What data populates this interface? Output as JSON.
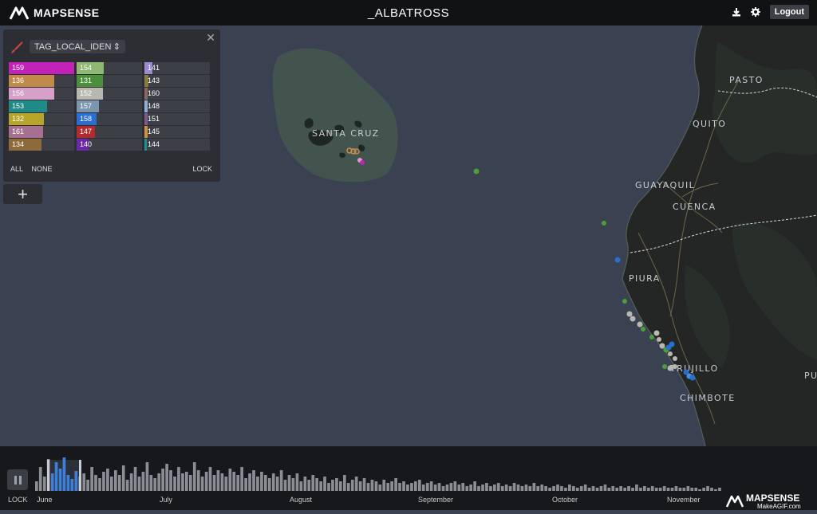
{
  "app": {
    "brand": "MAPSENSE",
    "title": "_ALBATROSS",
    "logout_label": "Logout"
  },
  "panel": {
    "dimension": "TAG_LOCAL_IDEN",
    "columns": [
      [
        {
          "label": "159",
          "color": "#c322b8",
          "fill": 1.0
        },
        {
          "label": "136",
          "color": "#c08a4a",
          "fill": 0.7
        },
        {
          "label": "156",
          "color": "#d7a0c8",
          "fill": 0.7
        },
        {
          "label": "153",
          "color": "#1f8a88",
          "fill": 0.58
        },
        {
          "label": "132",
          "color": "#b7a42a",
          "fill": 0.54
        },
        {
          "label": "161",
          "color": "#a87090",
          "fill": 0.52
        },
        {
          "label": "134",
          "color": "#8d6a3a",
          "fill": 0.5
        }
      ],
      [
        {
          "label": "154",
          "color": "#8fb873",
          "fill": 0.42
        },
        {
          "label": "131",
          "color": "#4b8e3c",
          "fill": 0.4
        },
        {
          "label": "152",
          "color": "#b8b8b0",
          "fill": 0.4
        },
        {
          "label": "157",
          "color": "#7d96b0",
          "fill": 0.34
        },
        {
          "label": "158",
          "color": "#2a6fd0",
          "fill": 0.3
        },
        {
          "label": "147",
          "color": "#b32a2a",
          "fill": 0.28
        },
        {
          "label": "140",
          "color": "#6a2aa8",
          "fill": 0.18
        }
      ],
      [
        {
          "label": "141",
          "color": "#9a8ad0",
          "fill": 0.12
        },
        {
          "label": "143",
          "color": "#8a7a3a",
          "fill": 0.06
        },
        {
          "label": "160",
          "color": "#8a6a60",
          "fill": 0.05
        },
        {
          "label": "148",
          "color": "#8ab0d8",
          "fill": 0.05
        },
        {
          "label": "151",
          "color": "#7d5a8a",
          "fill": 0.05
        },
        {
          "label": "145",
          "color": "#d09040",
          "fill": 0.05
        },
        {
          "label": "144",
          "color": "#1f9090",
          "fill": 0.04
        }
      ]
    ],
    "all_label": "ALL",
    "none_label": "NONE",
    "lock_label": "LOCK"
  },
  "map": {
    "place_labels": [
      {
        "name": "SANTA CRUZ",
        "key": "santa_cruz"
      },
      {
        "name": "PASTO",
        "key": "pasto"
      },
      {
        "name": "QUITO",
        "key": "quito"
      },
      {
        "name": "GUAYAQUIL",
        "key": "guayaquil"
      },
      {
        "name": "CUENCA",
        "key": "cuenca"
      },
      {
        "name": "PIURA",
        "key": "piura"
      },
      {
        "name": "TRUJILLO",
        "key": "trujillo"
      },
      {
        "name": "CHIMBOTE",
        "key": "chimbote"
      },
      {
        "name": "PU",
        "key": "pu"
      }
    ]
  },
  "timeline": {
    "lock_label": "LOCK",
    "months": [
      "June",
      "July",
      "August",
      "September",
      "October",
      "November"
    ],
    "histogram": [
      12,
      30,
      18,
      40,
      22,
      36,
      28,
      42,
      20,
      15,
      25,
      18,
      22,
      14,
      30,
      20,
      16,
      24,
      28,
      18,
      26,
      20,
      32,
      14,
      22,
      30,
      18,
      24,
      36,
      20,
      16,
      22,
      28,
      34,
      26,
      18,
      30,
      22,
      24,
      20,
      36,
      26,
      18,
      24,
      30,
      20,
      26,
      22,
      18,
      28,
      24,
      20,
      30,
      16,
      22,
      26,
      18,
      24,
      20,
      16,
      22,
      18,
      26,
      14,
      20,
      16,
      22,
      12,
      18,
      14,
      20,
      16,
      12,
      18,
      10,
      14,
      16,
      12,
      20,
      10,
      14,
      18,
      12,
      16,
      10,
      14,
      12,
      8,
      14,
      10,
      12,
      16,
      10,
      12,
      8,
      10,
      12,
      14,
      8,
      10,
      12,
      8,
      10,
      6,
      8,
      10,
      12,
      8,
      10,
      6,
      8,
      12,
      6,
      8,
      10,
      6,
      8,
      10,
      6,
      8,
      6,
      10,
      8,
      6,
      8,
      6,
      10,
      6,
      8,
      6,
      4,
      6,
      8,
      6,
      4,
      8,
      6,
      4,
      6,
      8,
      4,
      6,
      4,
      6,
      8,
      4,
      6,
      4,
      6,
      4,
      6,
      4,
      8,
      4,
      6,
      4,
      6,
      4,
      4,
      6,
      4,
      4,
      6,
      4,
      4,
      6,
      4,
      4,
      2,
      4,
      6,
      4,
      2,
      4
    ]
  },
  "watermark": {
    "brand": "MAPSENSE",
    "site": "MakeAGIF.com"
  }
}
